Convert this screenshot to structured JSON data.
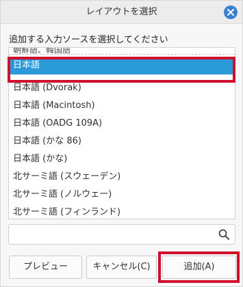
{
  "window": {
    "title": "レイアウトを選択",
    "close_icon": "close-icon",
    "accent_color": "#3a7fd0"
  },
  "prompt": "追加する入力ソースを選択してください",
  "list": {
    "partial_item": "朝鮮語、韓国語",
    "items": [
      {
        "label": "日本語",
        "selected": true
      },
      {
        "label": "日本語 (Dvorak)",
        "selected": false
      },
      {
        "label": "日本語 (Macintosh)",
        "selected": false
      },
      {
        "label": "日本語 (OADG 109A)",
        "selected": false
      },
      {
        "label": "日本語 (かな 86)",
        "selected": false
      },
      {
        "label": "日本語 (かな)",
        "selected": false
      },
      {
        "label": "北サーミ語 (スウェーデン)",
        "selected": false
      },
      {
        "label": "北サーミ語 (ノルウェー)",
        "selected": false
      },
      {
        "label": "北サーミ語 (フィンランド)",
        "selected": false
      }
    ],
    "selection_color": "#2a9ad8"
  },
  "search": {
    "value": "",
    "placeholder": "",
    "icon": "search-icon"
  },
  "buttons": {
    "preview": "プレビュー",
    "cancel": "キャンセル(C)",
    "add": "追加(A)"
  },
  "annotation_color": "#d0102a"
}
